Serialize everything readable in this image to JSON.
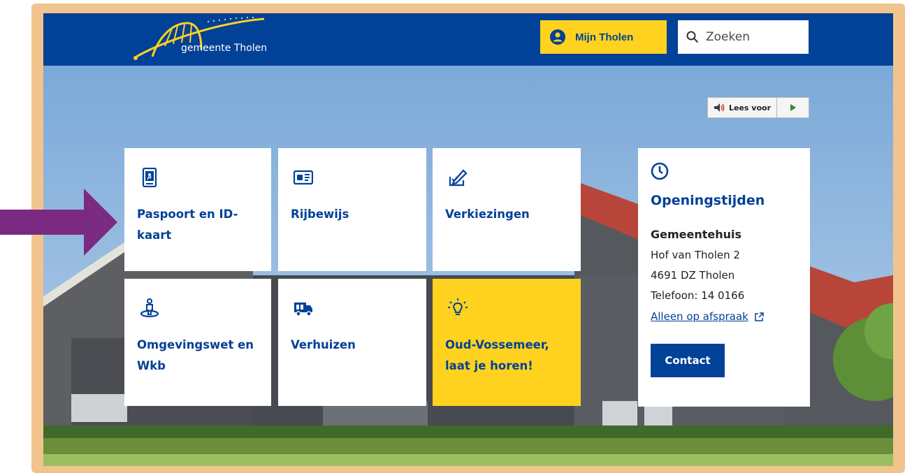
{
  "site": {
    "logo_text": "gemeente Tholen"
  },
  "header": {
    "account_label": "Mijn Tholen",
    "search_placeholder": "Zoeken"
  },
  "readspeaker": {
    "label": "Lees voor"
  },
  "tiles": [
    {
      "label": "Paspoort en ID-kaart",
      "icon": "passport-icon"
    },
    {
      "label": "Rijbewijs",
      "icon": "id-card-icon"
    },
    {
      "label": "Verkiezingen",
      "icon": "vote-pen-icon"
    },
    {
      "label": "Omgevingswet en Wkb",
      "icon": "person-location-icon"
    },
    {
      "label": "Verhuizen",
      "icon": "moving-truck-icon"
    },
    {
      "label": "Oud-Vossemeer, laat je horen!",
      "icon": "lightbulb-icon"
    }
  ],
  "opening": {
    "title": "Openingstijden",
    "location": "Gemeentehuis",
    "address1": "Hof van Tholen 2",
    "address2": "4691 DZ Tholen",
    "phone": "Telefoon: 14 0166",
    "appointment_link": "Alleen op afspraak",
    "contact_button": "Contact"
  },
  "colors": {
    "brand_blue": "#014197",
    "brand_yellow": "#fed21f",
    "frame": "#f2c48d",
    "annotation_arrow": "#7b2a82"
  }
}
